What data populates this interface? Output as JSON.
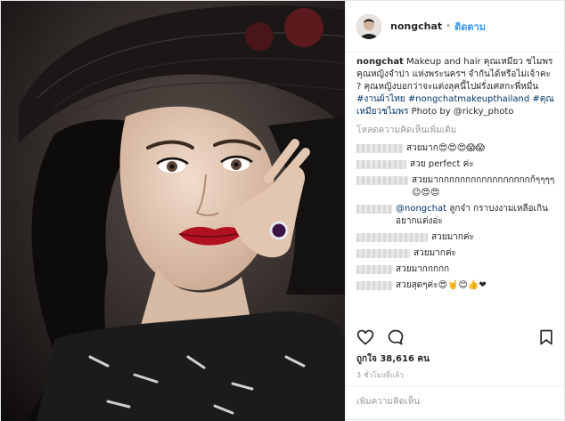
{
  "header": {
    "username": "nongchat",
    "separator": "•",
    "follow_label": "ติดตาม"
  },
  "caption": {
    "username": "nongchat",
    "text": "Makeup and hair คุณเหมียว ชไมพร คุณหญิงจำปา แห่งพระนครฯ จำกันได้หรือไม่เจ้าคะ ? คุณหญิงบอกว่าจะแต่งลุคนี้ไปฝรั่งเศสกะพี่หมื่น",
    "tags": [
      "#งานผ้าไทย",
      "#nongchatmakeupthailand",
      "#คุณเหมียวชไมพร"
    ],
    "photo_credit": "Photo by @ricky_photo"
  },
  "load_more": "โหลดความคิดเห็นเพิ่มเติม",
  "comments": [
    {
      "text": "สวยมาก😍😍😍😱😱"
    },
    {
      "text": "สวย perfect ค่ะ"
    },
    {
      "text": "สวยมากกกกกกกกกกกกกกกกกก้ๆๆๆๆ😉😍😍"
    },
    {
      "mention": "@nongchat",
      "text": "ลูกจ๋า กราบงงามเหลือเกิน อยากแต่งอ่ะ"
    },
    {
      "text": "สวยมากค่ะ"
    },
    {
      "text": "สวยมากค่ะ"
    },
    {
      "text": "สวยมากกกกก"
    },
    {
      "text": "สวยสุดๆค่ะ😍🤘😊👍❤"
    }
  ],
  "actions": {
    "like": "heart-icon",
    "comment": "comment-icon",
    "save": "bookmark-icon"
  },
  "likes": "ถูกใจ 38,616 คน",
  "timestamp": "3 ชั่วโมงที่แล้ว",
  "add_comment_placeholder": "เพิ่มความคิดเห็น"
}
